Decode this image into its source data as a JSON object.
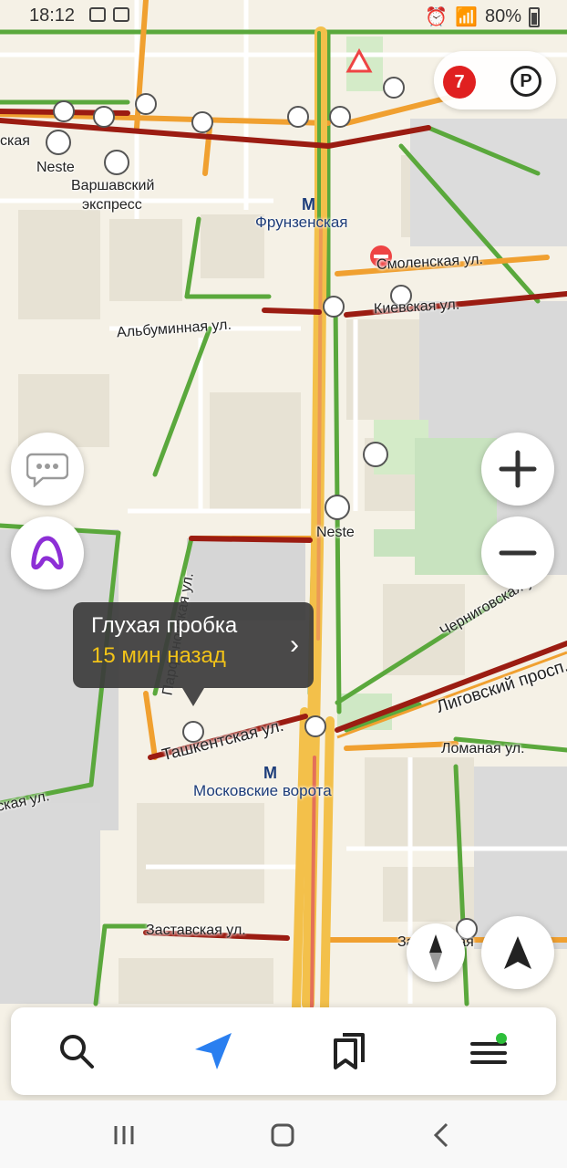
{
  "status_bar": {
    "time": "18:12",
    "battery": "80%"
  },
  "map": {
    "labels": {
      "neste_top": "Neste",
      "varshavsky": "Варшавский",
      "express": "экспресс",
      "frunzenskaya": "Фрунзенская",
      "smolenskaya": "Смоленская ул.",
      "kievskaya": "Киевская ул.",
      "albuminnaya": "Альбуминная ул.",
      "neste_mid": "Neste",
      "chernigovskaya": "Черниговская ул.",
      "parfenovskaya": "Парфёновская ул.",
      "ligovsky": "Лиговский просп.",
      "tashkentskaya": "Ташкентская ул.",
      "lomanaya": "Ломаная ул.",
      "moskovskie_vorota": "Московские ворота",
      "zastavskaya": "Заставская ул.",
      "zastavskaya_right": "Заставская",
      "left_street": "ская ул.",
      "left_top_street": "ская"
    },
    "traffic_level": "7",
    "parking_label": "P"
  },
  "tooltip": {
    "title": "Глухая пробка",
    "subtitle": "15 мин назад"
  },
  "colors": {
    "accent": "#2a7ff0",
    "traffic_red": "#e02020",
    "jam": "#9b1c12",
    "free": "#5aa83c",
    "slow": "#f0a030",
    "alice": "#8d2fd6"
  },
  "icons": [
    "chat-icon",
    "alice-icon",
    "plus-icon",
    "minus-icon",
    "compass-icon",
    "navigation-arrow-icon",
    "search-icon",
    "route-icon",
    "bookmarks-icon",
    "menu-icon"
  ]
}
